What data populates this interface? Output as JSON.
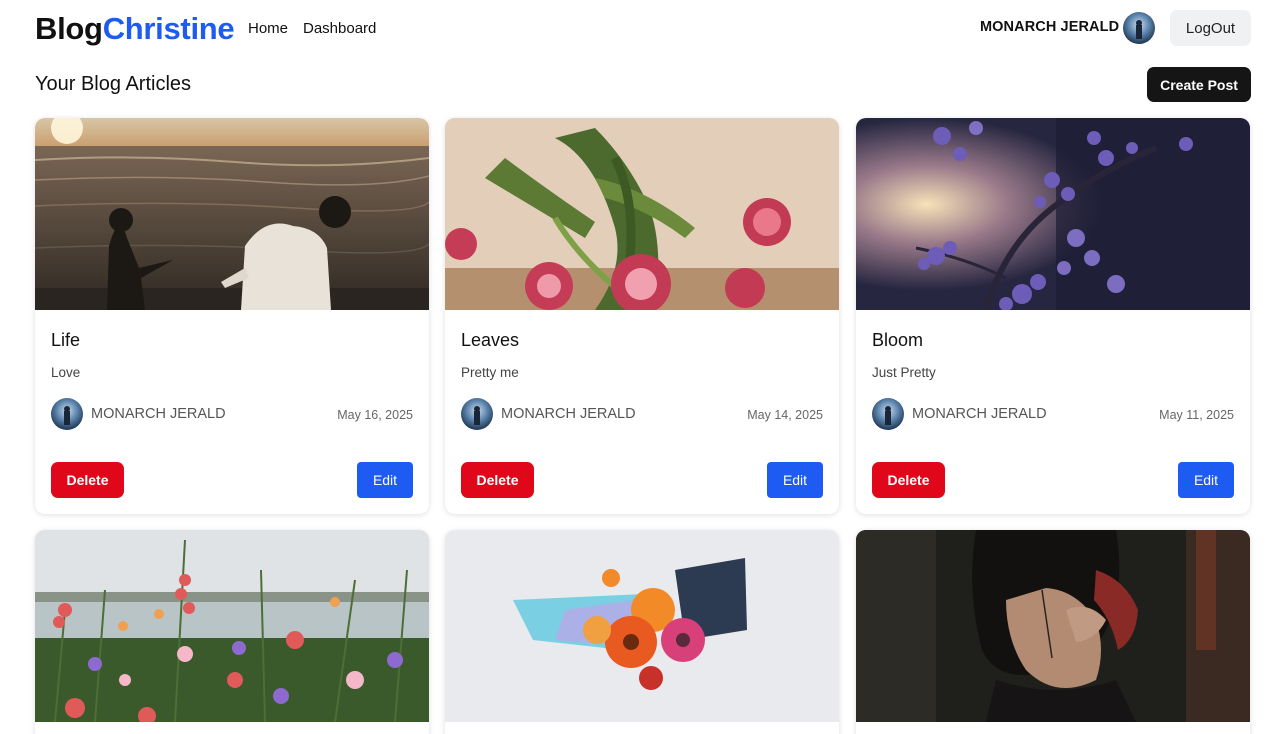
{
  "nav": {
    "brand_part1": "Blog",
    "brand_part2": "Christine",
    "links": [
      "Home",
      "Dashboard"
    ],
    "user_name": "MONARCH JERALD",
    "logout_label": "LogOut"
  },
  "main": {
    "section_title": "Your Blog Articles",
    "create_label": "Create Post"
  },
  "posts": [
    {
      "title": "Life",
      "description": "Love",
      "author": "MONARCH JERALD",
      "date": "May 16, 2025",
      "delete_label": "Delete",
      "edit_label": "Edit",
      "image": "beach-couple-sunset-photo"
    },
    {
      "title": "Leaves",
      "description": "Pretty me",
      "author": "MONARCH JERALD",
      "date": "May 14, 2025",
      "delete_label": "Delete",
      "edit_label": "Edit",
      "image": "pink-flowers-vase-photo"
    },
    {
      "title": "Bloom",
      "description": "Just Pretty",
      "author": "MONARCH JERALD",
      "date": "May 11, 2025",
      "delete_label": "Delete",
      "edit_label": "Edit",
      "image": "purple-blossoms-photo"
    },
    {
      "image": "wildflowers-field-photo"
    },
    {
      "image": "flower-bouquet-paper-photo"
    },
    {
      "image": "dark-portrait-photo"
    }
  ],
  "colors": {
    "accent": "#1d5bf2",
    "danger": "#e0071b",
    "primary_dark": "#151515"
  }
}
